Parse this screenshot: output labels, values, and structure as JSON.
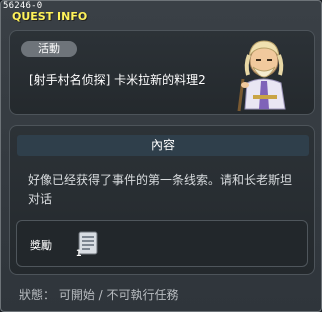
{
  "window": {
    "quest_id": "56246-0",
    "title": "QUEST INFO"
  },
  "quest": {
    "category": "活動",
    "name": "[射手村名侦探] 卡米拉新的料理2",
    "npc_icon": "elder-npc-portrait"
  },
  "content": {
    "header": "內容",
    "description": "好像已经获得了事件的第一条线索。请和长老斯坦对话"
  },
  "reward": {
    "label": "獎勵",
    "item_icon": "item-document-icon",
    "quantity": "1"
  },
  "status": {
    "text": "狀態： 可開始 / 不可執行任務"
  }
}
